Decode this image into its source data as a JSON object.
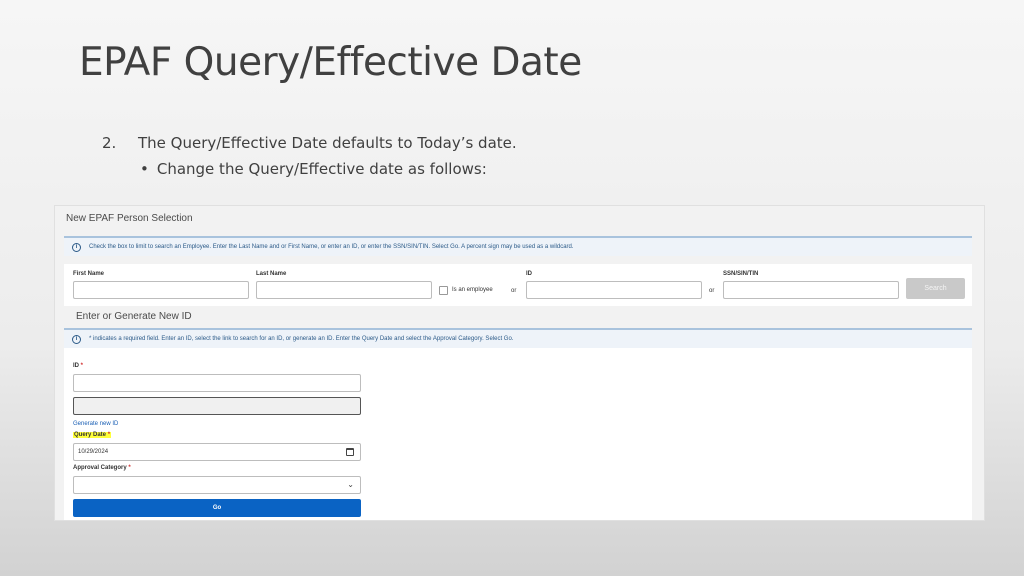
{
  "slide": {
    "title": "EPAF Query/Effective Date",
    "step_number": "2.",
    "step_text": "The Query/Effective Date defaults to Today’s date.",
    "bullet_symbol": "•",
    "bullet_text": "Change the Query/Effective date as follows:"
  },
  "screen": {
    "header": "New EPAF Person Selection",
    "info_icon": "i",
    "info_search": "Check the box to limit to search an Employee. Enter the Last Name and or First Name, or enter an ID, or enter the SSN/SIN/TIN. Select Go. A percent sign may be used as a wildcard.",
    "search": {
      "first_name_label": "First Name",
      "last_name_label": "Last Name",
      "employee_checkbox_label": "Is an employee",
      "or_1": "or",
      "id_label": "ID",
      "or_2": "or",
      "ssn_label": "SSN/SIN/TIN",
      "search_button": "Search"
    },
    "section_title": "Enter or Generate New ID",
    "info_generate": "* indicates a required field. Enter an ID, select the link to search for an ID, or generate an ID. Enter the Query Date and select the Approval Category. Select Go.",
    "form": {
      "id_label": "ID",
      "required_mark": "*",
      "generate_link": "Generate new ID",
      "query_date_label": "Query Date",
      "query_date_value": "10/29/2024",
      "approval_category_label": "Approval Category",
      "go_button": "Go"
    },
    "icons": {
      "info": "info-icon",
      "calendar": "calendar-icon",
      "dropdown": "chevron-down-icon"
    },
    "colors": {
      "go_button": "#0a63c4",
      "highlight": "#ffff3a",
      "link": "#1a5fb4"
    }
  }
}
